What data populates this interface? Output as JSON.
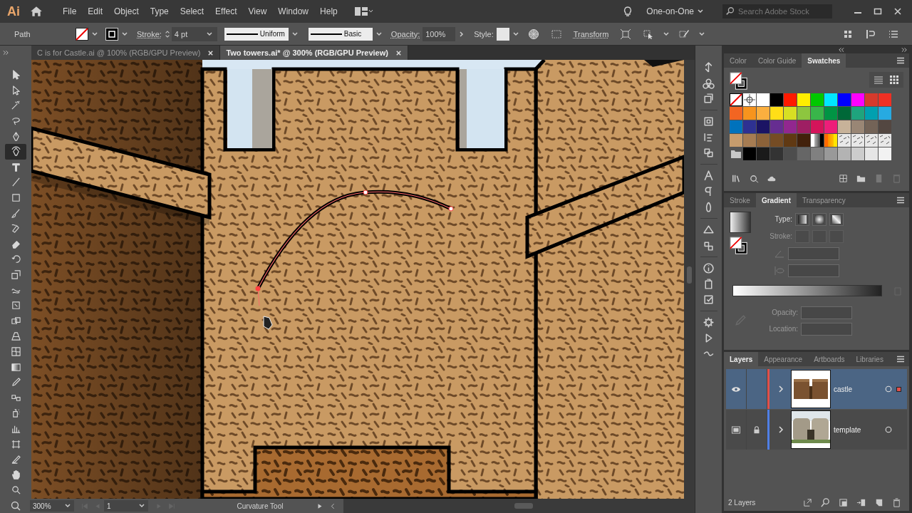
{
  "app": {
    "logo": "Ai"
  },
  "menu": [
    "File",
    "Edit",
    "Object",
    "Type",
    "Select",
    "Effect",
    "View",
    "Window",
    "Help"
  ],
  "workspace": "One-on-One",
  "search": {
    "placeholder": "Search Adobe Stock"
  },
  "control_bar": {
    "object_type": "Path",
    "stroke_label": "Stroke:",
    "stroke_weight": "4 pt",
    "variable_width": "Uniform",
    "brush": "Basic",
    "opacity_label": "Opacity:",
    "opacity": "100%",
    "style_label": "Style:",
    "transform": "Transform"
  },
  "document_tabs": [
    {
      "title": "C is for Castle.ai @ 100% (RGB/GPU Preview)",
      "selected": false
    },
    {
      "title": "Two towers.ai* @ 300% (RGB/GPU Preview)",
      "selected": true
    }
  ],
  "tools": [
    {
      "kind": "selection",
      "selected": false
    },
    {
      "kind": "direct",
      "selected": false
    },
    {
      "kind": "wand",
      "selected": false
    },
    {
      "kind": "lasso",
      "selected": false
    },
    {
      "kind": "pen",
      "selected": false
    },
    {
      "kind": "curvature",
      "selected": true
    },
    {
      "kind": "type",
      "selected": false
    },
    {
      "kind": "line",
      "selected": false
    },
    {
      "kind": "rect",
      "selected": false
    },
    {
      "kind": "brush",
      "selected": false
    },
    {
      "kind": "shaper",
      "selected": false
    },
    {
      "kind": "eraser",
      "selected": false
    },
    {
      "kind": "rotate",
      "selected": false
    },
    {
      "kind": "scale",
      "selected": false
    },
    {
      "kind": "warp",
      "selected": false
    },
    {
      "kind": "transform",
      "selected": false
    },
    {
      "kind": "builder",
      "selected": false
    },
    {
      "kind": "perspective",
      "selected": false
    },
    {
      "kind": "mesh",
      "selected": false
    },
    {
      "kind": "gradient",
      "selected": false
    },
    {
      "kind": "eyedropper",
      "selected": false
    },
    {
      "kind": "blend",
      "selected": false
    },
    {
      "kind": "spray",
      "selected": false
    },
    {
      "kind": "graph",
      "selected": false
    },
    {
      "kind": "artboard",
      "selected": false
    },
    {
      "kind": "slice",
      "selected": false
    },
    {
      "kind": "hand",
      "selected": false
    },
    {
      "kind": "zoom",
      "selected": false
    }
  ],
  "status_bar": {
    "zoom": "300%",
    "artboard": "1",
    "current_tool": "Curvature Tool"
  },
  "swatches_panel": {
    "view_modes": [
      {
        "kind": "list",
        "selected": false
      },
      {
        "kind": "grid",
        "selected": true
      }
    ],
    "tabs": [
      {
        "label": "Color",
        "selected": false
      },
      {
        "label": "Color Guide",
        "selected": false
      },
      {
        "label": "Swatches",
        "selected": true
      }
    ],
    "swatches": [
      {
        "kind": "none"
      },
      {
        "kind": "registration"
      },
      {
        "kind": "color",
        "color": "#ffffff"
      },
      {
        "kind": "color",
        "color": "#000000"
      },
      {
        "kind": "color",
        "color": "#ff1a00"
      },
      {
        "kind": "color",
        "color": "#ffee00"
      },
      {
        "kind": "color",
        "color": "#00c800"
      },
      {
        "kind": "color",
        "color": "#00e6ff"
      },
      {
        "kind": "color",
        "color": "#0000ff"
      },
      {
        "kind": "color",
        "color": "#ff00ff"
      },
      {
        "kind": "color",
        "color": "#d63a2c"
      },
      {
        "kind": "color",
        "color": "#f03023"
      },
      {
        "kind": "color",
        "color": "#f26522"
      },
      {
        "kind": "color",
        "color": "#f7941d"
      },
      {
        "kind": "color",
        "color": "#fbaf3f"
      },
      {
        "kind": "color",
        "color": "#ffde17"
      },
      {
        "kind": "color",
        "color": "#d7df23"
      },
      {
        "kind": "color",
        "color": "#8dc63f"
      },
      {
        "kind": "color",
        "color": "#39b54a"
      },
      {
        "kind": "color",
        "color": "#009444"
      },
      {
        "kind": "color",
        "color": "#006838"
      },
      {
        "kind": "color",
        "color": "#1fa47d"
      },
      {
        "kind": "color",
        "color": "#00a0b0"
      },
      {
        "kind": "color",
        "color": "#27aae1"
      },
      {
        "kind": "color",
        "color": "#0072bc"
      },
      {
        "kind": "color",
        "color": "#2e3192"
      },
      {
        "kind": "color",
        "color": "#1b1464"
      },
      {
        "kind": "color",
        "color": "#662d91"
      },
      {
        "kind": "color",
        "color": "#92278f"
      },
      {
        "kind": "color",
        "color": "#9e1f63"
      },
      {
        "kind": "color",
        "color": "#d4145a"
      },
      {
        "kind": "color",
        "color": "#ed1e79"
      },
      {
        "kind": "color",
        "color": "#c7b299"
      },
      {
        "kind": "color",
        "color": "#998675"
      },
      {
        "kind": "color",
        "color": "#736357"
      },
      {
        "kind": "color",
        "color": "#534741"
      },
      {
        "kind": "color",
        "color": "#c69c6d"
      },
      {
        "kind": "color",
        "color": "#a67c52"
      },
      {
        "kind": "color",
        "color": "#8c6239"
      },
      {
        "kind": "color",
        "color": "#754c24"
      },
      {
        "kind": "color",
        "color": "#603913"
      },
      {
        "kind": "color",
        "color": "#42210b"
      },
      {
        "kind": "gradient",
        "stops": [
          {
            "color": "#ffffff"
          },
          {
            "color": "#000000"
          }
        ]
      },
      {
        "kind": "gradient",
        "stops": [
          {
            "color": "#ff6a00"
          },
          {
            "color": "#ffe600"
          }
        ]
      },
      {
        "kind": "pattern"
      },
      {
        "kind": "pattern"
      },
      {
        "kind": "pattern"
      },
      {
        "kind": "pattern"
      },
      {
        "kind": "folder"
      },
      {
        "kind": "color",
        "color": "#000000"
      },
      {
        "kind": "color",
        "color": "#1a1a1a"
      },
      {
        "kind": "color",
        "color": "#333333"
      },
      {
        "kind": "color",
        "color": "#4d4d4d"
      },
      {
        "kind": "color",
        "color": "#666666"
      },
      {
        "kind": "color",
        "color": "#808080"
      },
      {
        "kind": "color",
        "color": "#999999"
      },
      {
        "kind": "color",
        "color": "#b3b3b3"
      },
      {
        "kind": "color",
        "color": "#cccccc"
      },
      {
        "kind": "color",
        "color": "#e6e6e6"
      },
      {
        "kind": "color",
        "color": "#f2f2f2"
      }
    ]
  },
  "gradient_panel": {
    "tabs": [
      {
        "label": "Stroke",
        "selected": false
      },
      {
        "label": "Gradient",
        "selected": true
      },
      {
        "label": "Transparency",
        "selected": false
      }
    ],
    "type": {
      "label": "Type:",
      "disabled": false
    },
    "stroke": {
      "label": "Stroke:",
      "disabled": true
    },
    "opacity": {
      "label": "Opacity:",
      "disabled": true
    },
    "location": {
      "label": "Location:",
      "disabled": true
    }
  },
  "layers_panel": {
    "tabs": [
      {
        "label": "Layers",
        "selected": true
      },
      {
        "label": "Appearance",
        "selected": false
      },
      {
        "label": "Artboards",
        "selected": false
      },
      {
        "label": "Libraries",
        "selected": false
      }
    ],
    "layers": [
      {
        "name": "castle",
        "template_view": false,
        "locked": false,
        "selected": true,
        "color": "#e2504b",
        "has_selection": true
      },
      {
        "name": "template",
        "template_view": true,
        "locked": true,
        "selected": false,
        "color": "#4f7fe6",
        "has_selection": false
      }
    ],
    "count": "2 Layers"
  }
}
